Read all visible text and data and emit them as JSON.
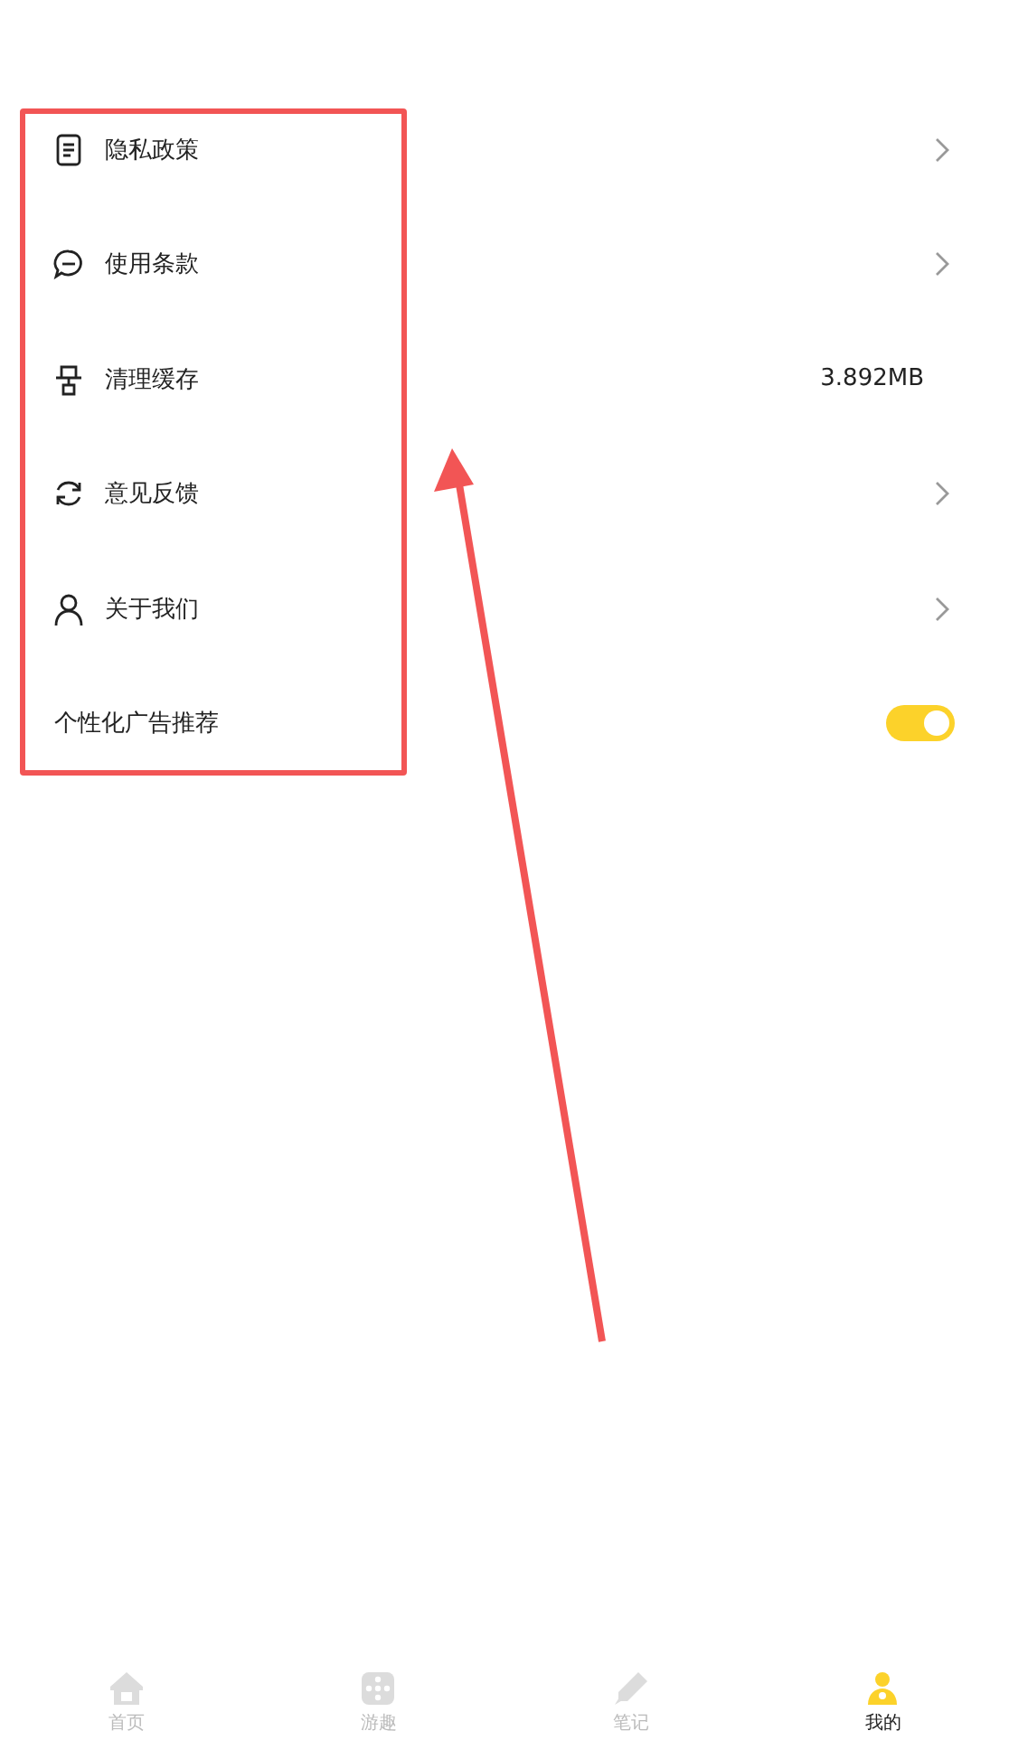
{
  "settings": [
    {
      "kind": "link",
      "label": "隐私政策"
    },
    {
      "kind": "link",
      "label": "使用条款"
    },
    {
      "kind": "value",
      "label": "清理缓存",
      "value": "3.892MB"
    },
    {
      "kind": "link",
      "label": "意见反馈"
    },
    {
      "kind": "link",
      "label": "关于我们"
    },
    {
      "kind": "switch",
      "label": "个性化广告推荐",
      "on": true
    }
  ],
  "tab_bar": [
    {
      "label": "首页",
      "selected": false
    },
    {
      "label": "游趣",
      "selected": false
    },
    {
      "label": "笔记",
      "selected": false
    },
    {
      "label": "我的",
      "selected": true
    }
  ]
}
